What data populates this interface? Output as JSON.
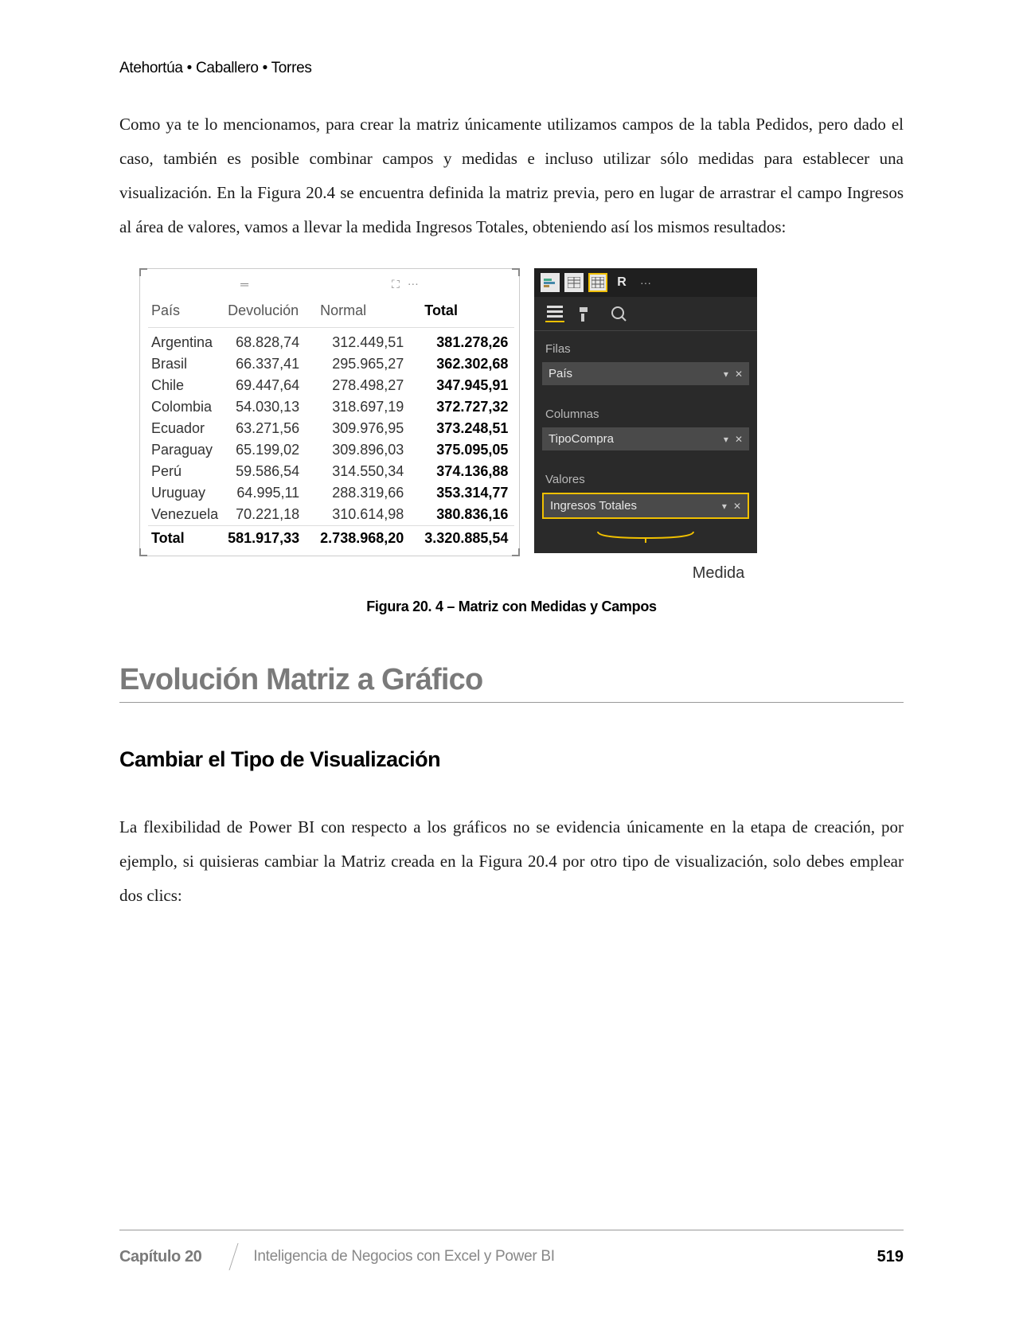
{
  "header": {
    "authors": "Atehortúa • Caballero • Torres"
  },
  "para1": "Como ya te lo mencionamos, para crear la matriz únicamente utilizamos campos de la tabla Pedidos, pero dado el caso, también es posible combinar campos y medidas e incluso utilizar sólo medidas para establecer una visualización. En la Figura 20.4 se encuentra definida la matriz previa, pero en lugar de arrastrar el campo Ingresos al área de valores, vamos a llevar la medida Ingresos Totales, obteniendo así los mismos resultados:",
  "matrix": {
    "headers": {
      "pais": "País",
      "devolucion": "Devolución",
      "normal": "Normal",
      "total": "Total"
    },
    "rows": [
      {
        "pais": "Argentina",
        "dev": "68.828,74",
        "nor": "312.449,51",
        "tot": "381.278,26"
      },
      {
        "pais": "Brasil",
        "dev": "66.337,41",
        "nor": "295.965,27",
        "tot": "362.302,68"
      },
      {
        "pais": "Chile",
        "dev": "69.447,64",
        "nor": "278.498,27",
        "tot": "347.945,91"
      },
      {
        "pais": "Colombia",
        "dev": "54.030,13",
        "nor": "318.697,19",
        "tot": "372.727,32"
      },
      {
        "pais": "Ecuador",
        "dev": "63.271,56",
        "nor": "309.976,95",
        "tot": "373.248,51"
      },
      {
        "pais": "Paraguay",
        "dev": "65.199,02",
        "nor": "309.896,03",
        "tot": "375.095,05"
      },
      {
        "pais": "Perú",
        "dev": "59.586,54",
        "nor": "314.550,34",
        "tot": "374.136,88"
      },
      {
        "pais": "Uruguay",
        "dev": "64.995,11",
        "nor": "288.319,66",
        "tot": "353.314,77"
      },
      {
        "pais": "Venezuela",
        "dev": "70.221,18",
        "nor": "310.614,98",
        "tot": "380.836,16"
      }
    ],
    "totalRow": {
      "label": "Total",
      "dev": "581.917,33",
      "nor": "2.738.968,20",
      "tot": "3.320.885,54"
    }
  },
  "panel": {
    "toolbarR": "R",
    "filas_label": "Filas",
    "filas_field": "País",
    "columnas_label": "Columnas",
    "columnas_field": "TipoCompra",
    "valores_label": "Valores",
    "valores_field": "Ingresos Totales"
  },
  "callout": "Medida",
  "caption": "Figura 20. 4 – Matriz con Medidas y Campos",
  "section": "Evolución Matriz a Gráfico",
  "subsection": "Cambiar el Tipo de Visualización",
  "para2": "La flexibilidad de Power BI con respecto a los gráficos no se evidencia únicamente en la etapa de creación, por ejemplo, si quisieras cambiar la Matriz creada en la Figura 20.4 por otro tipo de visualización, solo debes emplear dos clics:",
  "footer": {
    "chapter": "Capítulo 20",
    "title": "Inteligencia de Negocios con Excel y Power BI",
    "page": "519"
  }
}
